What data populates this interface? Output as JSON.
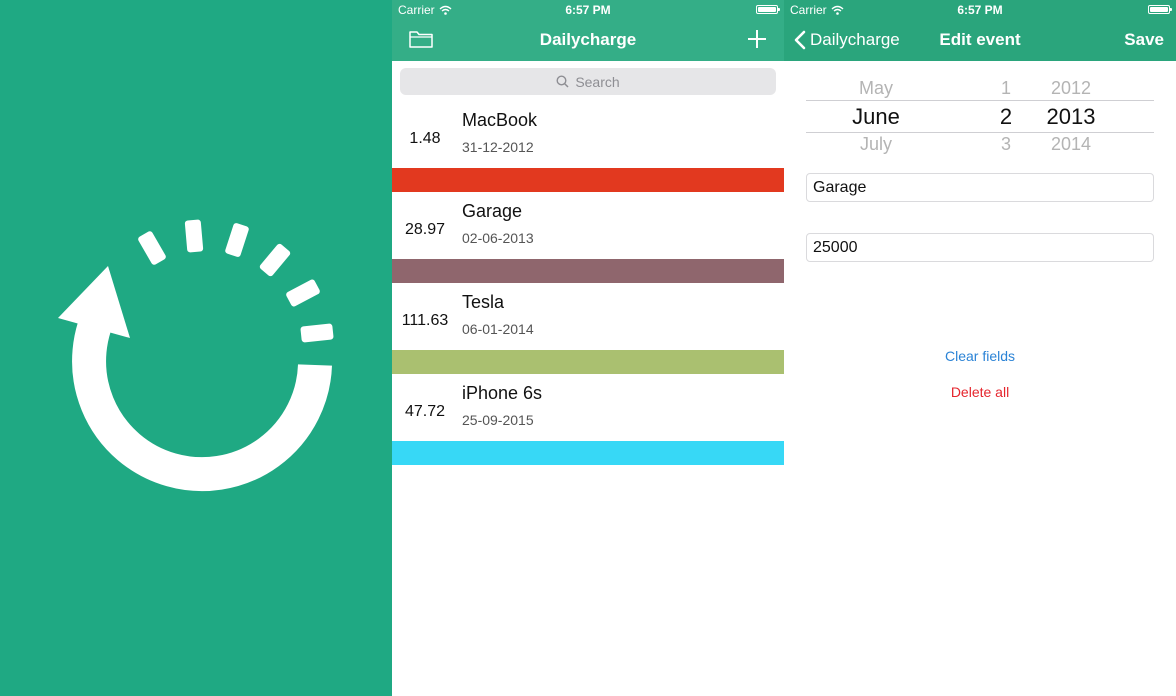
{
  "colors": {
    "brand_green": "#1fa983",
    "nav_green": "#34ae87",
    "link_blue": "#2b83d6",
    "danger_red": "#e5252d"
  },
  "status": {
    "carrier": "Carrier",
    "time": "6:57 PM"
  },
  "list_screen": {
    "title": "Dailycharge",
    "folder_icon": "folder-icon",
    "add_icon": "plus-icon",
    "search_placeholder": "Search",
    "events": [
      {
        "value": "1.48",
        "name": "MacBook",
        "date": "31-12-2012",
        "color": "#e2391f"
      },
      {
        "value": "28.97",
        "name": "Garage",
        "date": "02-06-2013",
        "color": "#8f666d"
      },
      {
        "value": "111.63",
        "name": "Tesla",
        "date": "06-01-2014",
        "color": "#aac070"
      },
      {
        "value": "47.72",
        "name": "iPhone 6s",
        "date": "25-09-2015",
        "color": "#37d8f6"
      }
    ]
  },
  "edit_screen": {
    "back_label": "Dailycharge",
    "title": "Edit event",
    "save_label": "Save",
    "picker": {
      "month": {
        "prev": "May",
        "selected": "June",
        "next": "July"
      },
      "day": {
        "prev": "1",
        "selected": "2",
        "next": "3"
      },
      "year": {
        "prev": "2012",
        "selected": "2013",
        "next": "2014"
      }
    },
    "name_value": "Garage",
    "amount_value": "25000",
    "clear_label": "Clear fields",
    "delete_label": "Delete all"
  }
}
